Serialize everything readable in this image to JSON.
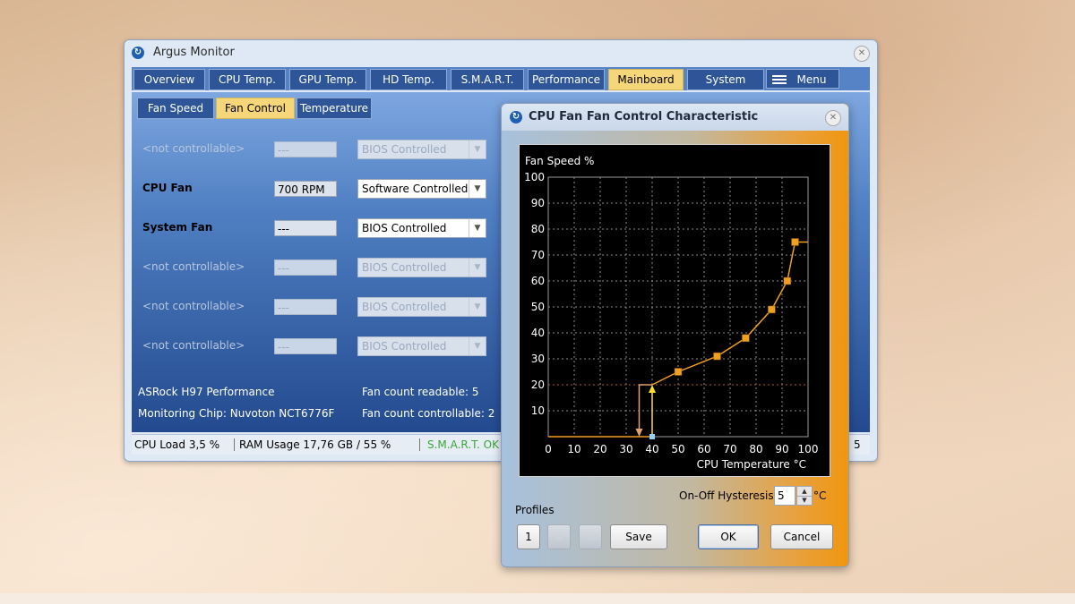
{
  "app": {
    "title": "Argus Monitor",
    "tabs": [
      {
        "label": "Overview",
        "active": false
      },
      {
        "label": "CPU Temp.",
        "active": false
      },
      {
        "label": "GPU Temp.",
        "active": false
      },
      {
        "label": "HD Temp.",
        "active": false
      },
      {
        "label": "S.M.A.R.T.",
        "active": false
      },
      {
        "label": "Performance",
        "active": false
      },
      {
        "label": "Mainboard",
        "active": true
      },
      {
        "label": "System",
        "active": false
      },
      {
        "label": "Menu",
        "active": false,
        "icon": "hamburger-icon"
      }
    ],
    "subtabs": [
      {
        "label": "Fan Speed",
        "active": false
      },
      {
        "label": "Fan Control",
        "active": true
      },
      {
        "label": "Temperature",
        "active": false
      }
    ],
    "fans": [
      {
        "name": "<not controllable>",
        "rpm": "---",
        "mode": "BIOS Controlled",
        "enabled": false
      },
      {
        "name": "CPU Fan",
        "rpm": "700 RPM",
        "mode": "Software Controlled",
        "enabled": true
      },
      {
        "name": "System Fan",
        "rpm": "---",
        "mode": "BIOS Controlled",
        "enabled": true
      },
      {
        "name": "<not controllable>",
        "rpm": "---",
        "mode": "BIOS Controlled",
        "enabled": false
      },
      {
        "name": "<not controllable>",
        "rpm": "---",
        "mode": "BIOS Controlled",
        "enabled": false
      },
      {
        "name": "<not controllable>",
        "rpm": "---",
        "mode": "BIOS Controlled",
        "enabled": false
      }
    ],
    "board": "ASRock H97 Performance",
    "chip": "Monitoring Chip: Nuvoton NCT6776F",
    "fan_count_readable": "Fan count readable: 5",
    "fan_count_controllable": "Fan count controllable: 2",
    "status": {
      "cpu_load": "CPU Load 3,5 %",
      "ram_usage": "RAM Usage 17,76 GB / 55 %",
      "smart": "S.M.A.R.T. OK",
      "right_digit": "5",
      "smart_color": "#7be07b"
    }
  },
  "dialog": {
    "title": "CPU Fan Fan Control Characteristic",
    "hysteresis_label": "On-Off Hysteresis",
    "hysteresis_value": "5",
    "hysteresis_unit": "°C",
    "profiles_label": "Profiles",
    "profile_buttons": [
      "1"
    ],
    "save_label": "Save",
    "ok_label": "OK",
    "cancel_label": "Cancel"
  },
  "chart_data": {
    "type": "line",
    "ylabel": "Fan Speed %",
    "xlabel": "CPU Temperature °C",
    "xlim": [
      0,
      100
    ],
    "ylim": [
      0,
      100
    ],
    "x_ticks": [
      "0",
      "10",
      "20",
      "30",
      "40",
      "50",
      "60",
      "70",
      "80",
      "90",
      "100"
    ],
    "y_ticks": [
      "10",
      "20",
      "30",
      "40",
      "50",
      "60",
      "70",
      "80",
      "90",
      "100"
    ],
    "grid": true,
    "curve": {
      "color": "#f0a020",
      "points": [
        {
          "x": 40,
          "y": 20
        },
        {
          "x": 50,
          "y": 25
        },
        {
          "x": 65,
          "y": 31
        },
        {
          "x": 76,
          "y": 38
        },
        {
          "x": 86,
          "y": 49
        },
        {
          "x": 92,
          "y": 60
        },
        {
          "x": 95,
          "y": 75
        }
      ],
      "end_y": 75
    },
    "hysteresis": {
      "on_temp": 40,
      "off_temp": 35,
      "level": 20
    },
    "base_line_y": 0,
    "guide_line_y": 20
  }
}
